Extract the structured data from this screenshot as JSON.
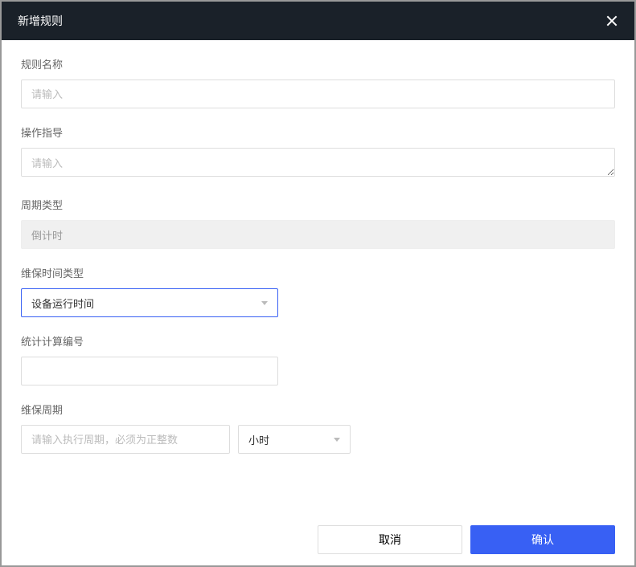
{
  "modal": {
    "title": "新增规则"
  },
  "form": {
    "rule_name": {
      "label": "规则名称",
      "placeholder": "请输入",
      "value": ""
    },
    "operation_guide": {
      "label": "操作指导",
      "placeholder": "请输入",
      "value": ""
    },
    "cycle_type": {
      "label": "周期类型",
      "value": "倒计时"
    },
    "maintenance_time_type": {
      "label": "维保时间类型",
      "value": "设备运行时间"
    },
    "stat_calc_number": {
      "label": "统计计算编号",
      "value": ""
    },
    "maintenance_cycle": {
      "label": "维保周期",
      "placeholder": "请输入执行周期，必须为正整数",
      "value": "",
      "unit": "小时"
    }
  },
  "footer": {
    "cancel": "取消",
    "confirm": "确认"
  }
}
